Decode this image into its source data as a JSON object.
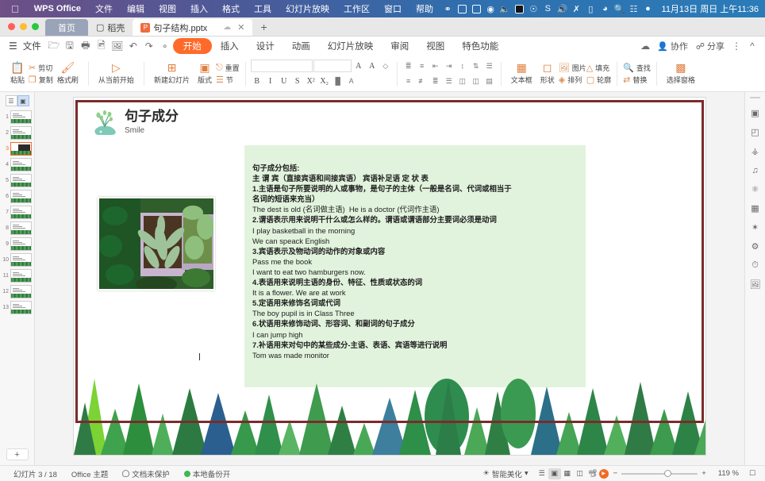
{
  "mac_menu": {
    "apple": "apple-logo",
    "items": [
      {
        "label": "WPS Office",
        "bold": true
      },
      {
        "label": "文件"
      },
      {
        "label": "编辑"
      },
      {
        "label": "视图"
      },
      {
        "label": "插入"
      },
      {
        "label": "格式"
      },
      {
        "label": "工具"
      },
      {
        "label": "幻灯片放映"
      },
      {
        "label": "工作区"
      },
      {
        "label": "窗口"
      },
      {
        "label": "帮助"
      }
    ],
    "tray_icons": [
      "sync-icon",
      "wechat-icon",
      "note-icon",
      "shield-icon",
      "speaker-mute-icon",
      "screen-icon",
      "bluetooth-icon",
      "stats-icon",
      "volume-icon",
      "airdrop-icon",
      "battery-icon",
      "wifi-icon",
      "search-icon",
      "control-center-icon",
      "siri-icon"
    ],
    "clock": "11月13日 周日 上午11:36"
  },
  "tabs": {
    "home_label": "首页",
    "docer_label": "稻壳",
    "file_label": "句子结构.pptx",
    "cloud_icon": "cloud-icon",
    "close_icon": "close-icon",
    "new_tab_icon": "plus-icon"
  },
  "ribbon": {
    "menu_icon": "hamburger-icon",
    "file_label": "文件",
    "quick_icons": [
      "open-icon",
      "save-icon",
      "print-icon",
      "print-preview-icon",
      "export-pdf-icon",
      "undo-icon",
      "redo-icon",
      "dropdown-icon"
    ],
    "tabs": [
      {
        "label": "开始",
        "selected": true
      },
      {
        "label": "插入",
        "selected": false
      },
      {
        "label": "设计",
        "selected": false
      },
      {
        "label": "动画",
        "selected": false
      },
      {
        "label": "幻灯片放映",
        "selected": false
      },
      {
        "label": "审阅",
        "selected": false
      },
      {
        "label": "视图",
        "selected": false
      },
      {
        "label": "特色功能",
        "selected": false
      }
    ],
    "cloud_status_icon": "cloud-sync-icon",
    "collab_label": "协作",
    "share_label": "分享",
    "more_icon": "more-icon",
    "collapse_icon": "chevron-up-icon"
  },
  "toolbar": {
    "paste": "粘贴",
    "cut": "剪切",
    "copy": "复制",
    "format_painter": "格式刷",
    "from_current": "从当前开始",
    "new_slide": "新建幻灯片",
    "layout": "版式",
    "section": "节",
    "reset": "重置",
    "font_name": "",
    "font_size": "",
    "grow_font": "A",
    "shrink_font": "A",
    "clear_format": "clear-format-icon",
    "bold": "B",
    "italic": "I",
    "underline": "U",
    "strike": "S",
    "superscript": "X²",
    "subscript": "X₂",
    "highlight": "highlight-icon",
    "font_color": "font-color-icon",
    "textbox": "文本框",
    "shape": "形状",
    "picture": "图片",
    "fill": "填充",
    "arrange": "排列",
    "outline": "轮廓",
    "find": "查找",
    "replace": "替换",
    "select_pane": "选择窗格"
  },
  "thumbnails": {
    "view_outline_icon": "outline-view-icon",
    "view_slide_icon": "slide-view-icon",
    "current": 3,
    "numbers": [
      1,
      2,
      3,
      4,
      5,
      6,
      7,
      8,
      9,
      10,
      11,
      12,
      13
    ],
    "add_label": "+"
  },
  "slide": {
    "title": "句子成分",
    "subtitle": "Smile",
    "title_icon": "potted-plant-icon",
    "photo_icon": "plant-photo",
    "body_lines": [
      {
        "text": "句子成分包括:",
        "cn": true
      },
      {
        "text": "主 谓 宾（直接宾语和间接宾语） 宾语补足语 定 状 表",
        "cn": true
      },
      {
        "text": "1.主语是句子所要说明的人或事物，是句子的主体（一般是名词、代词或相当于",
        "cn": true
      },
      {
        "text": "名词的短语来充当）",
        "cn": true
      },
      {
        "text": "The dest is old (名词做主语)  He is a doctor (代词作主语)",
        "cn": false
      },
      {
        "text": "2.谓语表示用来说明干什么或怎么样的。谓语或谓语部分主要词必须是动词",
        "cn": true
      },
      {
        "text": "I play basketball in the morning",
        "cn": false
      },
      {
        "text": "We can speack English",
        "cn": false
      },
      {
        "text": "3.宾语表示及物动词的动作的对象或内容",
        "cn": true
      },
      {
        "text": "Pass me the book",
        "cn": false
      },
      {
        "text": "I want to eat two hamburgers now.",
        "cn": false
      },
      {
        "text": "4.表语用来说明主语的身份、特征、性质或状态的词",
        "cn": true
      },
      {
        "text": "It is a flower. We are at work",
        "cn": false
      },
      {
        "text": "5.定语用来修饰名词或代词",
        "cn": true
      },
      {
        "text": "The boy pupil is in Class Three",
        "cn": false
      },
      {
        "text": "6.状语用来修饰动词、形容词、和副词的句子成分",
        "cn": true
      },
      {
        "text": "I can jump high",
        "cn": false
      },
      {
        "text": "7.补语用来对句中的某些成分-主语、表语、宾语等进行说明",
        "cn": true
      },
      {
        "text": "Tom was made monitor",
        "cn": false
      }
    ],
    "frame_color": "#7b2b2b",
    "textbox_bg": "#e2f3dd"
  },
  "rail": {
    "icons": [
      "slide-design-icon",
      "shape-tool-icon",
      "insert-element-icon",
      "media-icon",
      "effects-icon",
      "frame-icon",
      "ai-icon",
      "adjust-icon",
      "history-icon",
      "image-tool-icon"
    ]
  },
  "status": {
    "slide_indicator": "幻灯片 3 / 18",
    "theme": "Office 主题",
    "protection": "文档未保护",
    "backup": "本地备份开",
    "beautify": "智能美化",
    "view_icons": [
      "reading-view-icon",
      "normal-view-icon",
      "slide-sorter-icon",
      "notes-view-icon",
      "presenter-view-icon"
    ],
    "play_icon": "play-icon",
    "zoom_out": "−",
    "zoom_in": "+",
    "zoom_level": "119 %",
    "fit_icon": "fit-to-window-icon"
  }
}
